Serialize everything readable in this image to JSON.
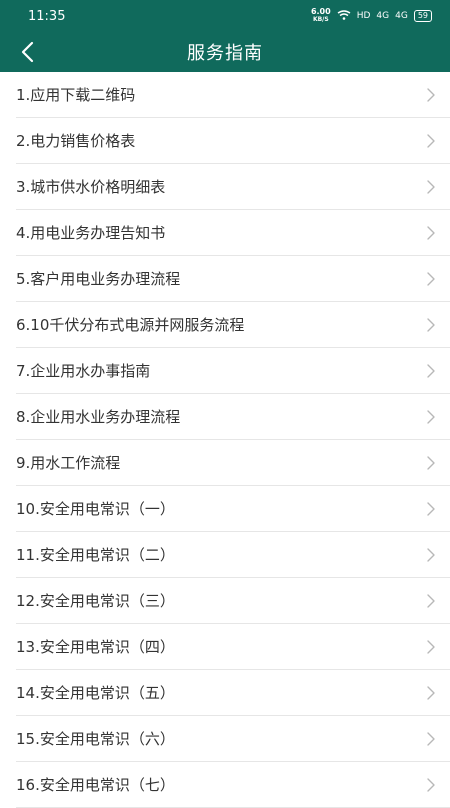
{
  "status": {
    "time": "11:35",
    "speed_value": "6.00",
    "speed_unit": "KB/S",
    "network": "HD",
    "signal1": "4G",
    "signal2": "4G",
    "battery": "59"
  },
  "header": {
    "title": "服务指南"
  },
  "items": [
    {
      "label": "1.应用下载二维码"
    },
    {
      "label": "2.电力销售价格表"
    },
    {
      "label": "3.城市供水价格明细表"
    },
    {
      "label": "4.用电业务办理告知书"
    },
    {
      "label": "5.客户用电业务办理流程"
    },
    {
      "label": "6.10千伏分布式电源并网服务流程"
    },
    {
      "label": "7.企业用水办事指南"
    },
    {
      "label": "8.企业用水业务办理流程"
    },
    {
      "label": "9.用水工作流程"
    },
    {
      "label": "10.安全用电常识（一）"
    },
    {
      "label": "11.安全用电常识（二）"
    },
    {
      "label": "12.安全用电常识（三）"
    },
    {
      "label": "13.安全用电常识（四）"
    },
    {
      "label": "14.安全用电常识（五）"
    },
    {
      "label": "15.安全用电常识（六）"
    },
    {
      "label": "16.安全用电常识（七）"
    }
  ],
  "colors": {
    "primary": "#106a5c",
    "divider": "#e6e6e6",
    "chevron": "#b8b8b8"
  }
}
